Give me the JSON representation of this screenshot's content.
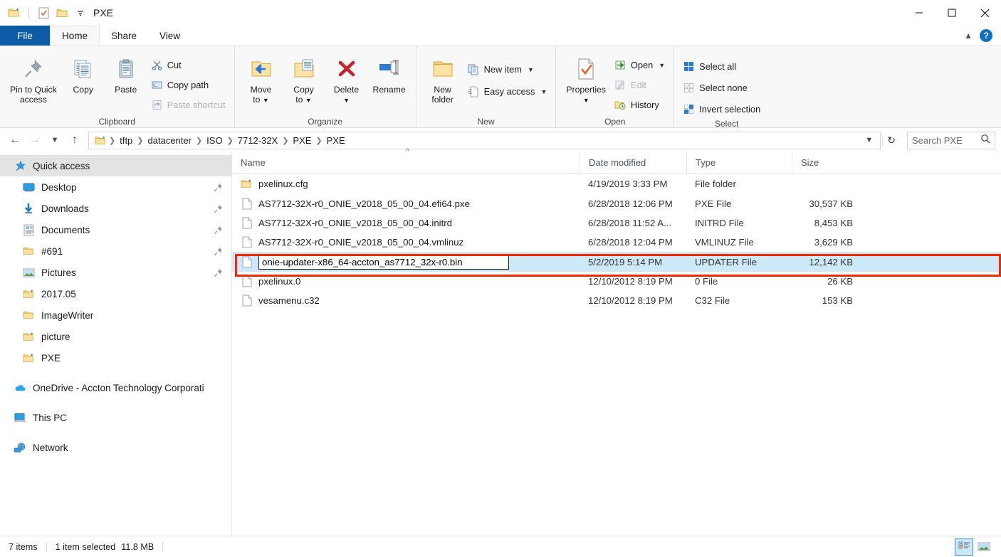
{
  "window": {
    "title": "PXE",
    "quick_access": [
      {
        "name": "folder-new-icon",
        "label": "New folder"
      },
      {
        "name": "properties-icon",
        "label": "Properties"
      },
      {
        "name": "folder-icon",
        "label": "Folder"
      },
      {
        "name": "customize-dropdown-icon",
        "label": "Customize Quick Access Toolbar"
      }
    ],
    "controls": [
      {
        "name": "minimize-button",
        "label": "Minimize"
      },
      {
        "name": "maximize-button",
        "label": "Maximize"
      },
      {
        "name": "close-button",
        "label": "Close"
      }
    ]
  },
  "ribbon": {
    "tabs": [
      {
        "label": "File",
        "active": false
      },
      {
        "label": "Home",
        "active": true
      },
      {
        "label": "Share",
        "active": false
      },
      {
        "label": "View",
        "active": false
      }
    ],
    "collapse_label": "Minimize the Ribbon",
    "help_label": "?",
    "groups": [
      {
        "label": "Clipboard",
        "big": [
          {
            "label": "Pin to Quick",
            "label2": "access",
            "icon": "pin-icon"
          },
          {
            "label": "Copy",
            "label2": "",
            "icon": "copy-icon"
          },
          {
            "label": "Paste",
            "label2": "",
            "icon": "paste-icon"
          }
        ],
        "small": [
          {
            "label": "Cut",
            "icon": "scissors-icon",
            "disabled": false
          },
          {
            "label": "Copy path",
            "icon": "copy-path-icon",
            "disabled": false
          },
          {
            "label": "Paste shortcut",
            "icon": "paste-shortcut-icon",
            "disabled": true
          }
        ]
      },
      {
        "label": "Organize",
        "big": [
          {
            "label": "Move",
            "label2": "to",
            "icon": "move-to-icon",
            "dropdown": true
          },
          {
            "label": "Copy",
            "label2": "to",
            "icon": "copy-to-icon",
            "dropdown": true
          },
          {
            "label": "Delete",
            "label2": "",
            "icon": "delete-icon",
            "dropdown": true
          },
          {
            "label": "Rename",
            "label2": "",
            "icon": "rename-icon"
          }
        ],
        "small": []
      },
      {
        "label": "New",
        "big": [
          {
            "label": "New",
            "label2": "folder",
            "icon": "new-folder-icon"
          }
        ],
        "small": [
          {
            "label": "New item",
            "icon": "new-item-icon",
            "dropdown": true
          },
          {
            "label": "Easy access",
            "icon": "easy-access-icon",
            "dropdown": true
          }
        ]
      },
      {
        "label": "Open",
        "big": [
          {
            "label": "Properties",
            "label2": "",
            "icon": "properties-icon",
            "dropdown": true
          }
        ],
        "small": [
          {
            "label": "Open",
            "icon": "open-icon",
            "dropdown": true,
            "disabled": false
          },
          {
            "label": "Edit",
            "icon": "edit-icon",
            "disabled": true
          },
          {
            "label": "History",
            "icon": "history-icon",
            "disabled": false
          }
        ]
      },
      {
        "label": "Select",
        "big": [],
        "small": [
          {
            "label": "Select all",
            "icon": "select-all-icon"
          },
          {
            "label": "Select none",
            "icon": "select-none-icon"
          },
          {
            "label": "Invert selection",
            "icon": "invert-selection-icon"
          }
        ]
      }
    ]
  },
  "address": {
    "back_label": "Back",
    "forward_label": "Forward",
    "recent_label": "Recent locations",
    "up_label": "Up",
    "breadcrumbs": [
      "tftp",
      "datacenter",
      "ISO",
      "7712-32X",
      "PXE",
      "PXE"
    ],
    "refresh_label": "Refresh",
    "dropdown_label": "Previous locations"
  },
  "search": {
    "placeholder": "Search PXE",
    "icon": "search-icon"
  },
  "sidebar": {
    "items": [
      {
        "label": "Quick access",
        "icon": "quick-access-star-icon",
        "level": 0,
        "selected": true,
        "pinned": false
      },
      {
        "label": "Desktop",
        "icon": "desktop-icon",
        "level": 1,
        "selected": false,
        "pinned": true
      },
      {
        "label": "Downloads",
        "icon": "downloads-icon",
        "level": 1,
        "selected": false,
        "pinned": true
      },
      {
        "label": "Documents",
        "icon": "documents-icon",
        "level": 1,
        "selected": false,
        "pinned": true
      },
      {
        "label": "#691",
        "icon": "folder-icon",
        "level": 1,
        "selected": false,
        "pinned": true
      },
      {
        "label": "Pictures",
        "icon": "pictures-icon",
        "level": 1,
        "selected": false,
        "pinned": true
      },
      {
        "label": "2017.05",
        "icon": "folder-shortcut-icon",
        "level": 1,
        "selected": false,
        "pinned": false
      },
      {
        "label": "ImageWriter",
        "icon": "folder-icon",
        "level": 1,
        "selected": false,
        "pinned": false
      },
      {
        "label": "picture",
        "icon": "folder-shortcut-icon",
        "level": 1,
        "selected": false,
        "pinned": false
      },
      {
        "label": "PXE",
        "icon": "folder-shortcut-icon",
        "level": 1,
        "selected": false,
        "pinned": false
      }
    ],
    "roots": [
      {
        "label": "OneDrive - Accton Technology Corporati",
        "icon": "onedrive-icon"
      },
      {
        "label": "This PC",
        "icon": "this-pc-icon"
      },
      {
        "label": "Network",
        "icon": "network-icon"
      }
    ]
  },
  "filelist": {
    "columns": [
      {
        "label": "Name",
        "sorted": true
      },
      {
        "label": "Date modified",
        "sorted": false
      },
      {
        "label": "Type",
        "sorted": false
      },
      {
        "label": "Size",
        "sorted": false
      }
    ],
    "sort_indicator": "^",
    "rows": [
      {
        "name": "pxelinux.cfg",
        "date": "4/19/2019 3:33 PM",
        "type": "File folder",
        "size": "",
        "icon": "folder-shortcut-icon",
        "selected": false,
        "renaming": false
      },
      {
        "name": "AS7712-32X-r0_ONIE_v2018_05_00_04.efi64.pxe",
        "date": "6/28/2018 12:06 PM",
        "type": "PXE File",
        "size": "30,537 KB",
        "icon": "file-icon",
        "selected": false,
        "renaming": false
      },
      {
        "name": "AS7712-32X-r0_ONIE_v2018_05_00_04.initrd",
        "date": "6/28/2018 11:52 A...",
        "type": "INITRD File",
        "size": "8,453 KB",
        "icon": "file-icon",
        "selected": false,
        "renaming": false
      },
      {
        "name": "AS7712-32X-r0_ONIE_v2018_05_00_04.vmlinuz",
        "date": "6/28/2018 12:04 PM",
        "type": "VMLINUZ File",
        "size": "3,629 KB",
        "icon": "file-icon",
        "selected": false,
        "renaming": false
      },
      {
        "name": "onie-updater-x86_64-accton_as7712_32x-r0.bin",
        "date": "5/2/2019 5:14 PM",
        "type": "UPDATER File",
        "size": "12,142 KB",
        "icon": "file-icon",
        "selected": true,
        "renaming": true
      },
      {
        "name": "pxelinux.0",
        "date": "12/10/2012 8:19 PM",
        "type": "0 File",
        "size": "26 KB",
        "icon": "file-icon",
        "selected": false,
        "renaming": false
      },
      {
        "name": "vesamenu.c32",
        "date": "12/10/2012 8:19 PM",
        "type": "C32 File",
        "size": "153 KB",
        "icon": "file-icon",
        "selected": false,
        "renaming": false
      }
    ],
    "highlight_color": "#f42800"
  },
  "status": {
    "items_count": "7 items",
    "selection": "1 item selected",
    "selection_size": "11.8 MB",
    "views": [
      {
        "name": "details-view-button",
        "label": "Details view",
        "active": true
      },
      {
        "name": "large-icons-view-button",
        "label": "Large icons view",
        "active": false
      }
    ]
  }
}
